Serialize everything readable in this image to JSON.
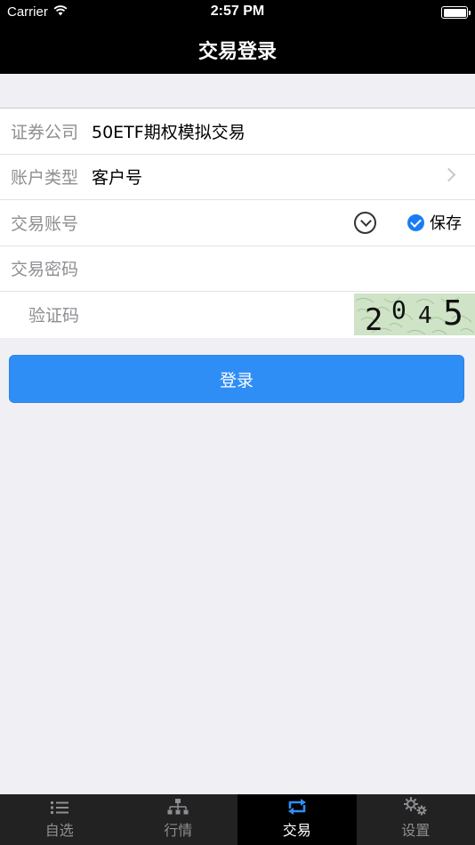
{
  "status_bar": {
    "carrier": "Carrier",
    "time": "2:57 PM",
    "wifi_icon": "wifi-icon",
    "battery_icon": "battery-icon"
  },
  "nav": {
    "title": "交易登录"
  },
  "form": {
    "broker": {
      "label": "证券公司",
      "value": "50ETF期权模拟交易"
    },
    "account_type": {
      "label": "账户类型",
      "value": "客户号",
      "icon": "chevron-right-icon"
    },
    "account": {
      "label": "交易账号",
      "value": "",
      "dropdown_icon": "chevron-down-circle-icon",
      "save_label": "保存",
      "save_checked": true
    },
    "password": {
      "label": "交易密码",
      "value": ""
    },
    "captcha": {
      "label": "验证码",
      "code": [
        "2",
        "0",
        "4",
        "5"
      ]
    }
  },
  "login_button": {
    "label": "登录"
  },
  "tabs": [
    {
      "label": "自选",
      "icon": "list-icon",
      "active": false
    },
    {
      "label": "行情",
      "icon": "hierarchy-icon",
      "active": false
    },
    {
      "label": "交易",
      "icon": "exchange-icon",
      "active": true
    },
    {
      "label": "设置",
      "icon": "gears-icon",
      "active": false
    }
  ],
  "colors": {
    "accent": "#2f8ef6",
    "nav_background": "#000000",
    "page_background": "#efeff4",
    "tab_bar_background": "#222222"
  }
}
